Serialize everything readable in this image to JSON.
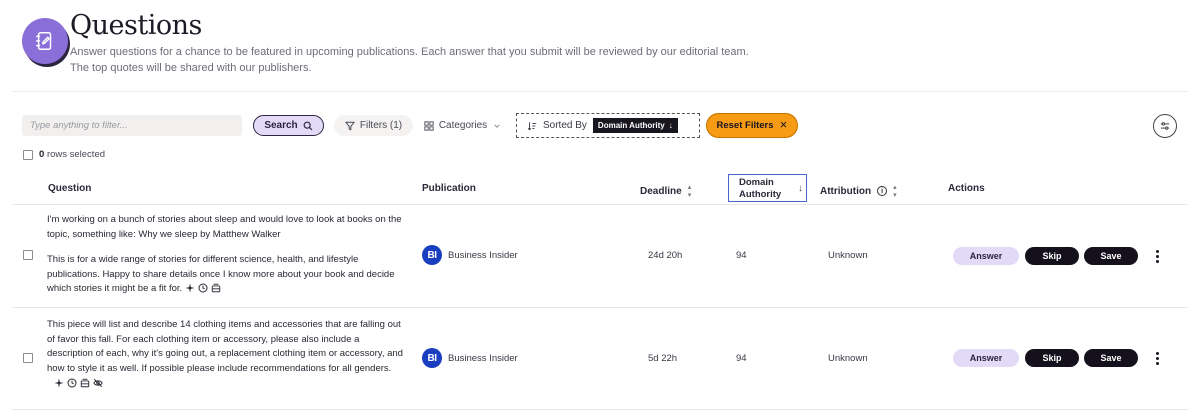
{
  "header": {
    "title": "Questions",
    "description": "Answer questions for a chance to be featured in upcoming publications. Each answer that you submit will be reviewed by our editorial team. The top quotes will be shared with our publishers.",
    "icon": "notebook-pen-icon"
  },
  "toolbar": {
    "filter_placeholder": "Type anything to filter...",
    "search_label": "Search",
    "filters_label": "Filters (1)",
    "categories_label": "Categories",
    "sorted_by_label": "Sorted By",
    "sort_value": "Domain Authority",
    "reset_label": "Reset Filters"
  },
  "selection": {
    "count": "0",
    "label": "rows selected"
  },
  "columns": {
    "question": "Question",
    "publication": "Publication",
    "deadline": "Deadline",
    "domain_authority_line1": "Domain",
    "domain_authority_line2": "Authority",
    "attribution": "Attribution",
    "actions": "Actions"
  },
  "rows": [
    {
      "question_p1": "I'm working on a bunch of stories about sleep and would love to look at books on the topic, something like: Why we sleep by Matthew Walker",
      "question_p2": "This is for a wide range of stories for different science, health, and lifestyle publications. Happy to share details once I know more about your book and decide which stories it might be a fit for.",
      "publication_logo": "BI",
      "publication": "Business Insider",
      "deadline": "24d 20h",
      "domain_authority": "94",
      "attribution": "Unknown"
    },
    {
      "question_p1": "This piece will list and describe 14 clothing items and accessories that are falling out of favor this fall. For each clothing item or accessory, please also include a description of each, why it's going out, a replacement clothing item or accessory, and how to style it as well. If possible please include recommendations for all genders.",
      "publication_logo": "BI",
      "publication": "Business Insider",
      "deadline": "5d 22h",
      "domain_authority": "94",
      "attribution": "Unknown"
    }
  ],
  "actions": {
    "answer": "Answer",
    "skip": "Skip",
    "save": "Save"
  },
  "colors": {
    "accent_purple": "#8b6fd8",
    "light_purple": "#e2daf6",
    "reset_orange": "#f79a14",
    "dark": "#14101c",
    "publication_blue": "#1a3ec0"
  }
}
